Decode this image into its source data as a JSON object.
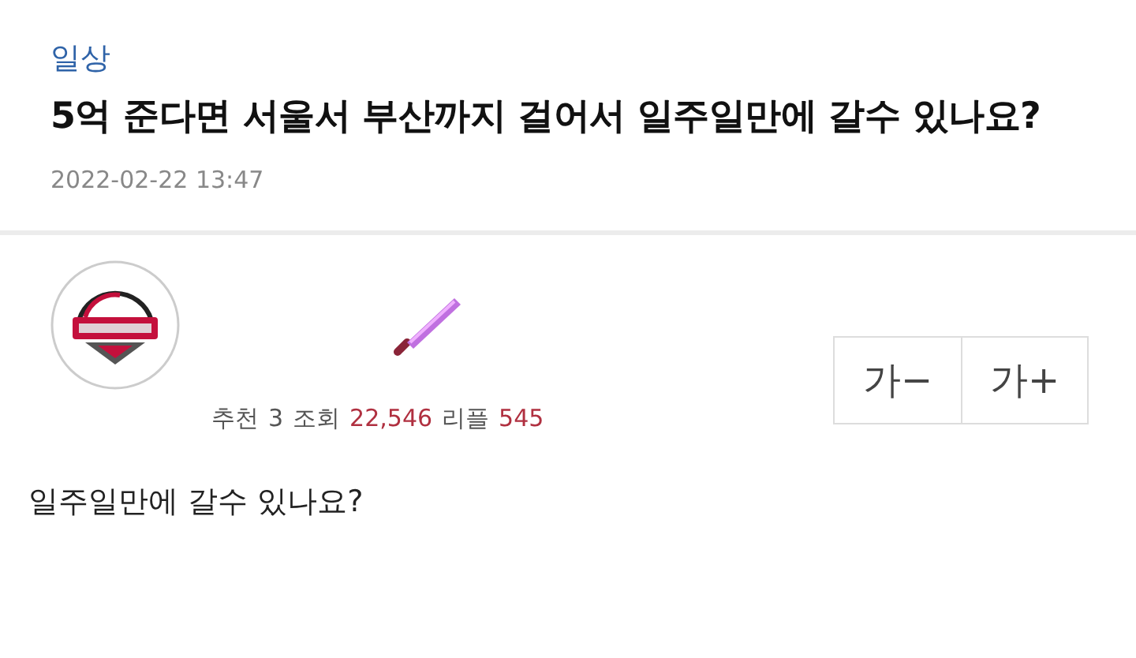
{
  "category": "일상",
  "title": "5억 준다면 서울서 부산까지 걸어서 일주일만에 갈수 있나요?",
  "date": "2022-02-22 13:47",
  "author": {
    "avatar": {
      "kind": "picture"
    }
  },
  "stats": [
    {
      "label": "추천",
      "value": "3",
      "highlight": false
    },
    {
      "label": "조회",
      "value": "22,546",
      "highlight": true
    },
    {
      "label": "리플",
      "value": "545",
      "highlight": true
    }
  ],
  "font_buttons": [
    "가−",
    "가+"
  ],
  "body": "일주일만에 갈수 있나요?"
}
